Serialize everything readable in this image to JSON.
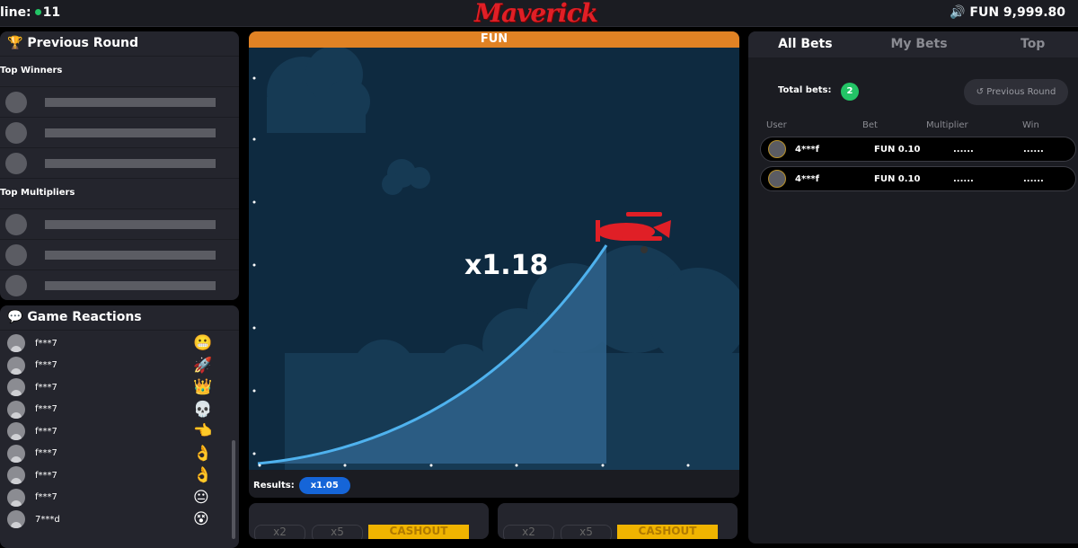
{
  "header": {
    "online_label": "line:",
    "online_count": "11",
    "logo": "Maverick",
    "balance": "FUN 9,999.80",
    "sound_icon": "speaker-icon"
  },
  "previous_round": {
    "title": "Previous Round",
    "top_winners": "Top Winners",
    "top_multipliers": "Top Multipliers"
  },
  "reactions": {
    "title": "Game Reactions",
    "items": [
      {
        "user": "f***7",
        "emoji": "😬"
      },
      {
        "user": "f***7",
        "emoji": "🚀"
      },
      {
        "user": "f***7",
        "emoji": "👑"
      },
      {
        "user": "f***7",
        "emoji": "💀"
      },
      {
        "user": "f***7",
        "emoji": "👈"
      },
      {
        "user": "f***7",
        "emoji": "👌"
      },
      {
        "user": "f***7",
        "emoji": "👌"
      },
      {
        "user": "f***7",
        "emoji": "😐"
      },
      {
        "user": "7***d",
        "emoji": "😵"
      }
    ]
  },
  "game": {
    "currency_banner": "FUN",
    "multiplier": "x1.18",
    "results_label": "Results:",
    "results": [
      "x1.05"
    ]
  },
  "bet_panels": [
    {
      "x2": "x2",
      "x5": "x5",
      "cashout": "CASHOUT"
    },
    {
      "x2": "x2",
      "x5": "x5",
      "cashout": "CASHOUT"
    }
  ],
  "bets": {
    "tabs": [
      "All Bets",
      "My Bets",
      "Top"
    ],
    "active_tab": "All Bets",
    "total_label": "Total bets:",
    "total": "2",
    "prev_round": "Previous Round",
    "columns": [
      "User",
      "Bet",
      "Multiplier",
      "Win"
    ],
    "rows": [
      {
        "user": "4***f",
        "bet": "FUN 0.10",
        "multiplier": "......",
        "win": "......"
      },
      {
        "user": "4***f",
        "bet": "FUN 0.10",
        "multiplier": "......",
        "win": "......"
      }
    ]
  },
  "colors": {
    "accent_orange": "#e08224",
    "online_green": "#23c466",
    "result_blue": "#1565d8",
    "cashout_yellow": "#f0b400",
    "plane_red": "#e01f26"
  }
}
